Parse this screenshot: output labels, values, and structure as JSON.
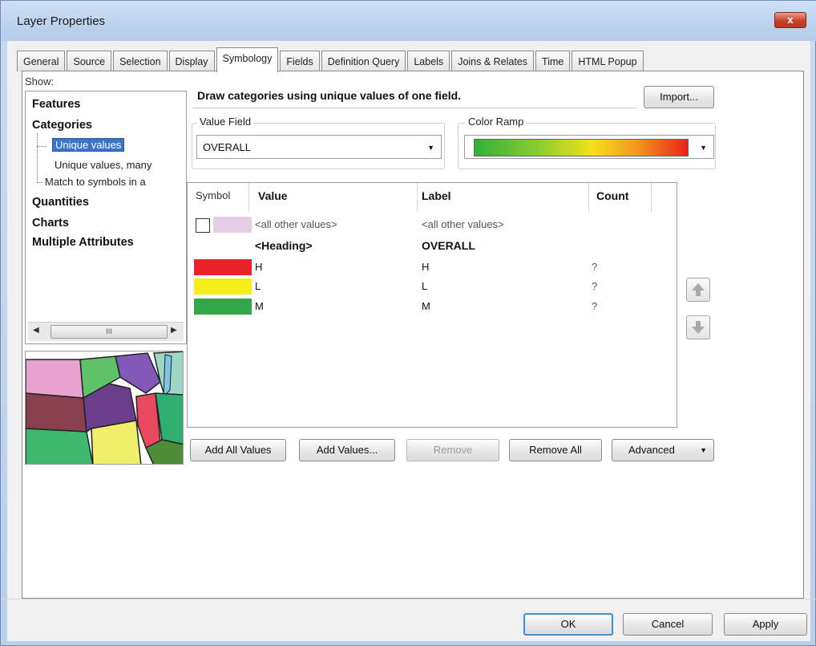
{
  "window": {
    "title": "Layer Properties",
    "close_label": "x"
  },
  "tabs": [
    {
      "label": "General"
    },
    {
      "label": "Source"
    },
    {
      "label": "Selection"
    },
    {
      "label": "Display"
    },
    {
      "label": "Symbology",
      "active": true
    },
    {
      "label": "Fields"
    },
    {
      "label": "Definition Query"
    },
    {
      "label": "Labels"
    },
    {
      "label": "Joins & Relates"
    },
    {
      "label": "Time"
    },
    {
      "label": "HTML Popup"
    }
  ],
  "show": {
    "label": "Show:",
    "items": {
      "features": "Features",
      "categories": "Categories",
      "unique_values": "Unique values",
      "unique_values_many": "Unique values, many",
      "match_to_symbols": "Match to symbols in a",
      "quantities": "Quantities",
      "charts": "Charts",
      "multiple_attributes": "Multiple Attributes"
    },
    "scrollbar_thumb": "III"
  },
  "description": "Draw categories using unique values of one field.",
  "import_label": "Import...",
  "value_field": {
    "label": "Value Field",
    "value": "OVERALL"
  },
  "color_ramp": {
    "label": "Color Ramp"
  },
  "table": {
    "headers": {
      "symbol": "Symbol",
      "value": "Value",
      "label": "Label",
      "count": "Count"
    },
    "rows": [
      {
        "value": "<all other values>",
        "label": "<all other values>",
        "count": "",
        "color": "#e6cde6",
        "checkbox": true
      },
      {
        "value": "<Heading>",
        "label": "OVERALL",
        "count": "",
        "heading": true
      },
      {
        "value": "H",
        "label": "H",
        "count": "?",
        "color": "#e8232a"
      },
      {
        "value": "L",
        "label": "L",
        "count": "?",
        "color": "#f5ee1a"
      },
      {
        "value": "M",
        "label": "M",
        "count": "?",
        "color": "#33a84a"
      }
    ]
  },
  "buttons": {
    "add_all": "Add All Values",
    "add_values": "Add Values...",
    "remove": "Remove",
    "remove_all": "Remove All",
    "advanced": "Advanced",
    "ok": "OK",
    "cancel": "Cancel",
    "apply": "Apply"
  },
  "icons": {
    "move_up": "arrow-up-icon",
    "move_down": "arrow-down-icon"
  }
}
